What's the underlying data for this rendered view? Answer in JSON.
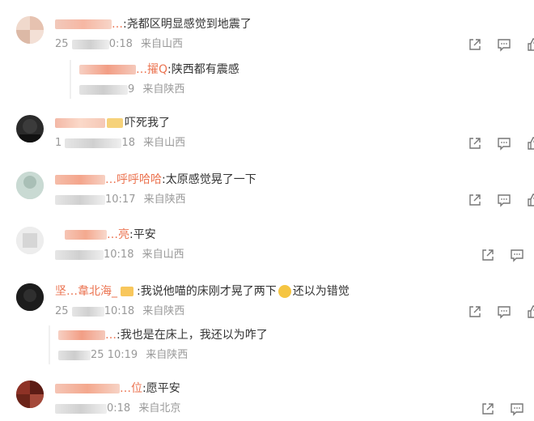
{
  "comments": [
    {
      "user": "…",
      "text": ":尧都区明显感觉到地震了",
      "date": "25",
      "time": "0:18",
      "source": "来自山西",
      "avatar_color": "#e8c8b8",
      "reply": {
        "user": "…擢Q",
        "text": ":陕西都有震感",
        "time": "9",
        "source": "来自陕西"
      }
    },
    {
      "user": "…",
      "text": "吓死我了",
      "date": "1",
      "time": "18",
      "source": "来自山西",
      "avatar_color": "#2a2a2a"
    },
    {
      "user": "…呼呼哈哈",
      "text": ":太原感觉晃了一下",
      "date": "",
      "time": "10:17",
      "source": "来自陕西",
      "avatar_color": "#b8cfc7"
    },
    {
      "user": "…亮",
      "text": ":平安",
      "date": "",
      "time": "10:18",
      "source": "来自山西",
      "avatar_color": "#d9d9d9"
    },
    {
      "user": "坚…韋北海_",
      "text": ":我说他喵的床刚才晃了两下",
      "text2": "还以为错觉",
      "date": "25",
      "time": "10:18",
      "source": "来自陕西",
      "avatar_color": "#1e1e1e",
      "reply": {
        "user": "…",
        "text": ":我也是在床上，我还以为咋了",
        "date": "25",
        "time": "10:19",
        "source": "来自陕西"
      }
    },
    {
      "user": "…位",
      "text": ":愿平安",
      "date": "",
      "time": "0:18",
      "source": "来自北京",
      "avatar_color": "#7a2a20"
    }
  ],
  "icons": {
    "share": "share-icon",
    "comment": "comment-icon",
    "like": "like-icon"
  }
}
